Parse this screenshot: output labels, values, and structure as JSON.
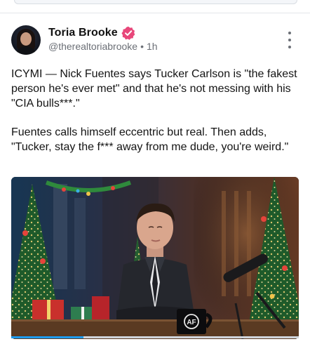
{
  "post": {
    "author": {
      "name": "Toria Brooke",
      "handle": "@therealtoriabrooke",
      "time": "1h",
      "verified": true
    },
    "text": {
      "p1": "ICYMI — Nick Fuentes says Tucker Carlson is \"the fakest person he's ever met\" and that he's not messing with his \"CIA bulls***.\"",
      "p2": "Fuentes calls himself eccentric but real. Then adds, \"Tucker, stay the f*** away from me dude, you're weird.\""
    },
    "media": {
      "type": "video",
      "progress": 0.25,
      "mug_logo": "AF"
    }
  },
  "icons": {
    "verified": "verified-badge-icon",
    "more": "more-vertical-icon"
  },
  "colors": {
    "verified_badge": "#e8477a",
    "progress": "#1d9bf0",
    "handle_text": "#6b6f76"
  }
}
